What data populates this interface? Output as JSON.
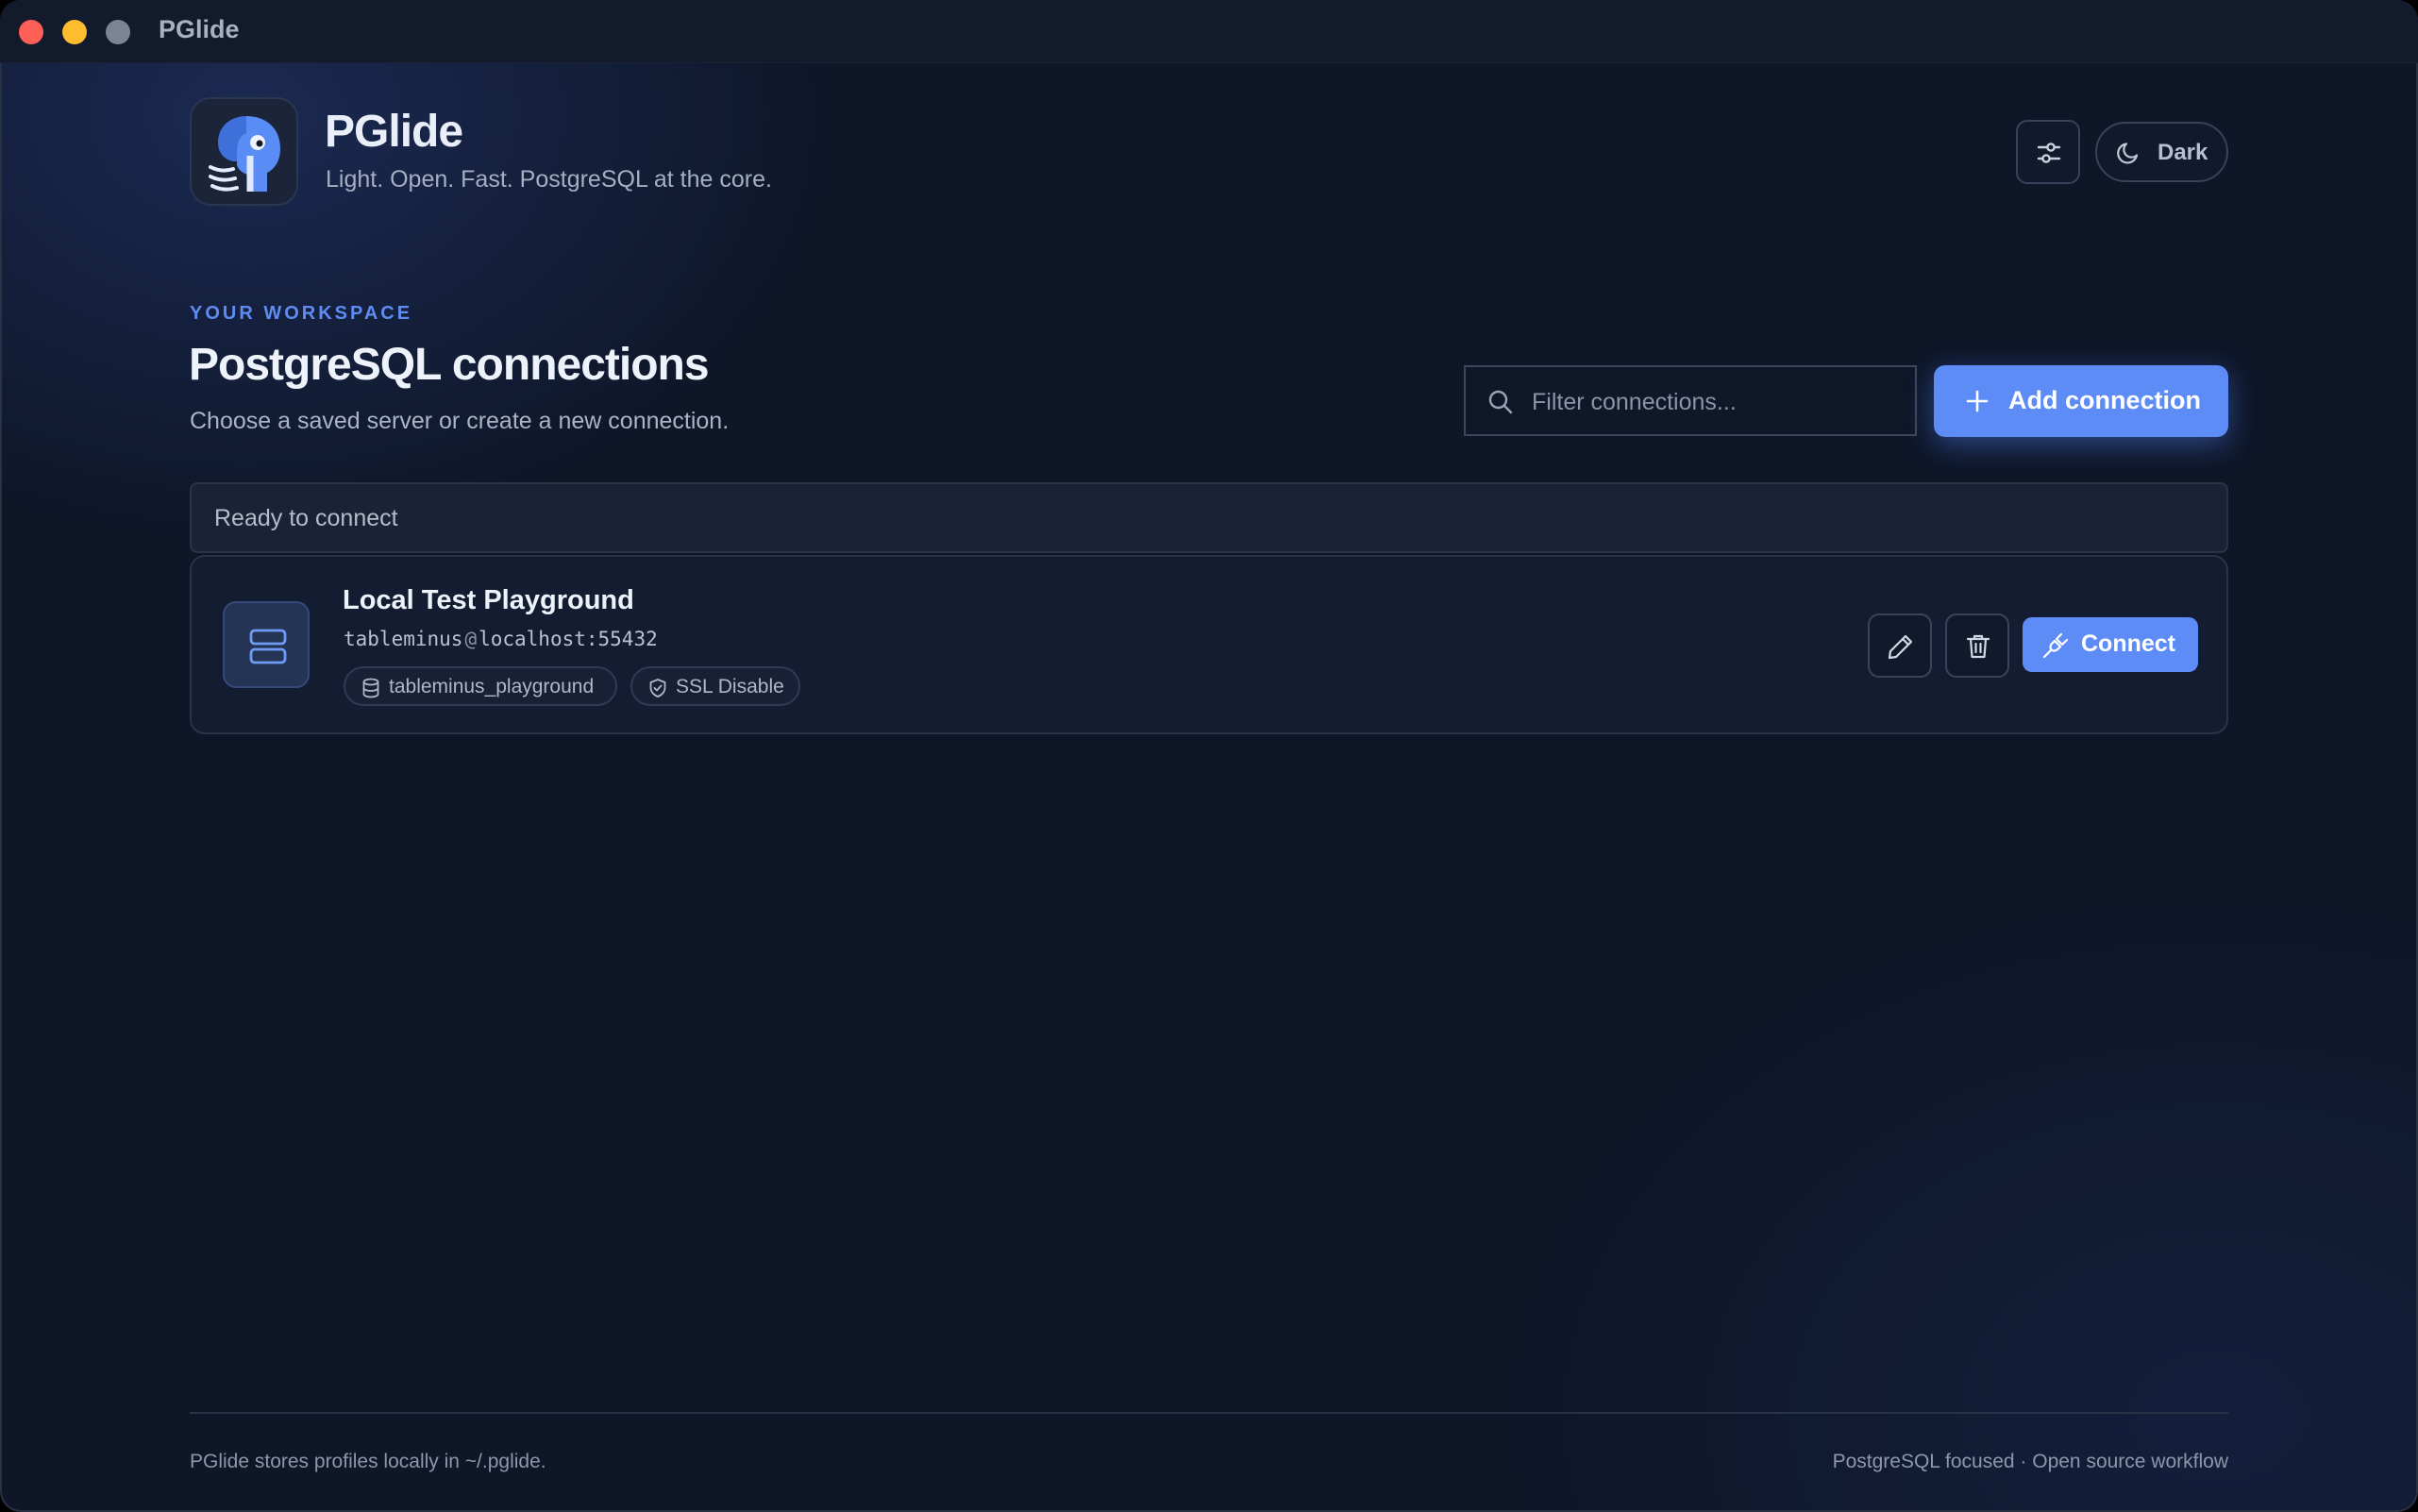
{
  "window": {
    "title": "PGlide"
  },
  "header": {
    "app_name": "PGlide",
    "tagline": "Light. Open. Fast. PostgreSQL at the core.",
    "settings_icon": "sliders-icon",
    "theme_icon": "moon-icon",
    "theme_label": "Dark"
  },
  "workspace": {
    "eyebrow": "YOUR WORKSPACE",
    "title": "PostgreSQL connections",
    "subtitle": "Choose a saved server or create a new connection.",
    "search": {
      "value": "",
      "placeholder": "Filter connections..."
    },
    "add_button_label": "Add connection"
  },
  "status": {
    "text": "Ready to connect"
  },
  "connections": [
    {
      "name": "Local Test Playground",
      "user": "tableminus",
      "host": "localhost:55432",
      "database": "tableminus_playground",
      "ssl": "SSL Disable",
      "connect_label": "Connect"
    }
  ],
  "footer": {
    "left": "PGlide stores profiles locally in ~/.pglide.",
    "right": "PostgreSQL focused · Open source workflow"
  },
  "colors": {
    "accent": "#5e8cf6",
    "background": "#0e1628",
    "eyebrow": "#5f8cf0"
  }
}
